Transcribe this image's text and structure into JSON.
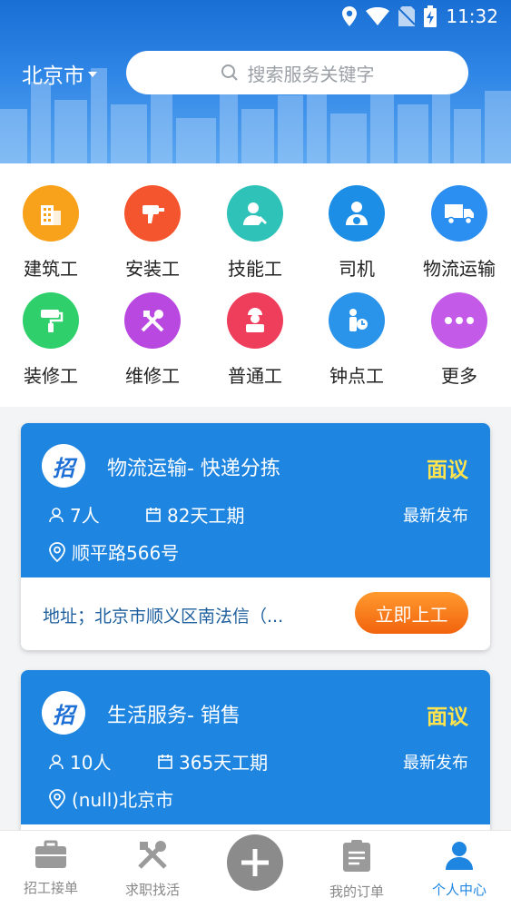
{
  "status_bar": {
    "time": "11:32"
  },
  "header": {
    "city": "北京市",
    "search_placeholder": "搜索服务关键字"
  },
  "categories": [
    {
      "label": "建筑工",
      "icon": "building-icon",
      "color": "#f8a21b"
    },
    {
      "label": "安装工",
      "icon": "drill-icon",
      "color": "#f4552e"
    },
    {
      "label": "技能工",
      "icon": "worker-wrench-icon",
      "color": "#2fc2b8"
    },
    {
      "label": "司机",
      "icon": "driver-icon",
      "color": "#1d8ee6"
    },
    {
      "label": "物流运输",
      "icon": "truck-icon",
      "color": "#2a8ff0"
    },
    {
      "label": "装修工",
      "icon": "paint-roller-icon",
      "color": "#2fcf6b"
    },
    {
      "label": "维修工",
      "icon": "tools-icon",
      "color": "#b848e0"
    },
    {
      "label": "普通工",
      "icon": "worker-icon",
      "color": "#ef3e5c"
    },
    {
      "label": "钟点工",
      "icon": "hourly-worker-icon",
      "color": "#2a93ea"
    },
    {
      "label": "更多",
      "icon": "more-icon",
      "color": "#c45ae8"
    }
  ],
  "jobs": [
    {
      "badge": "招",
      "title": "物流运输- 快递分拣",
      "salary": "面议",
      "people": "7人",
      "duration": "82天工期",
      "tag": "最新发布",
      "location": "顺平路566号",
      "address": "地址；北京市顺义区南法信（...",
      "button": "立即上工"
    },
    {
      "badge": "招",
      "title": "生活服务- 销售",
      "salary": "面议",
      "people": "10人",
      "duration": "365天工期",
      "tag": "最新发布",
      "location": "(null)北京市",
      "address": "",
      "button": ""
    }
  ],
  "nav": [
    {
      "label": "招工接单",
      "icon": "briefcase-icon",
      "active": false
    },
    {
      "label": "求职找活",
      "icon": "tools-icon",
      "active": false
    },
    {
      "label": "我的订单",
      "icon": "clipboard-icon",
      "active": false
    },
    {
      "label": "个人中心",
      "icon": "person-icon",
      "active": true
    }
  ],
  "colors": {
    "primary": "#1e85e0",
    "accent": "#ffe44d",
    "button": "#f2630d"
  }
}
